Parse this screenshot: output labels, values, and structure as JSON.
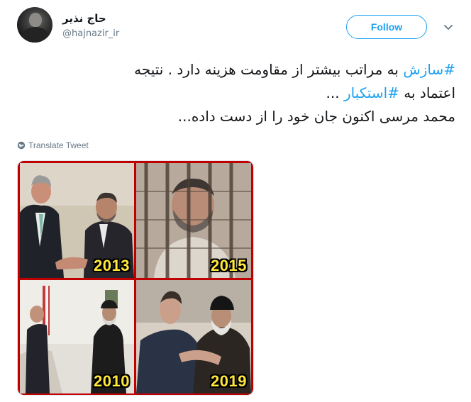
{
  "account": {
    "display_name": "حاج نذیر",
    "username": "@hajnazir_ir"
  },
  "follow_label": "Follow",
  "tweet": {
    "line1": {
      "hashtag": "#سازش",
      "text": " به مراتب بیشتر از مقاومت هزینه دارد . نتیجه"
    },
    "line2": {
      "text_before": "اعتماد به ",
      "hashtag": "#استکبار",
      "text_after": " ..."
    },
    "line3": "محمد مرسی اکنون جان خود را از دست داده..."
  },
  "translate_label": "Translate Tweet",
  "media": {
    "years": [
      "2013",
      "2015",
      "2010",
      "2019"
    ]
  },
  "colors": {
    "accent": "#1da1f2",
    "secondary_text": "#657786",
    "frame": "#c00000",
    "year_label": "#ffe83a"
  },
  "icons": [
    "caret-down-icon",
    "globe-icon"
  ]
}
